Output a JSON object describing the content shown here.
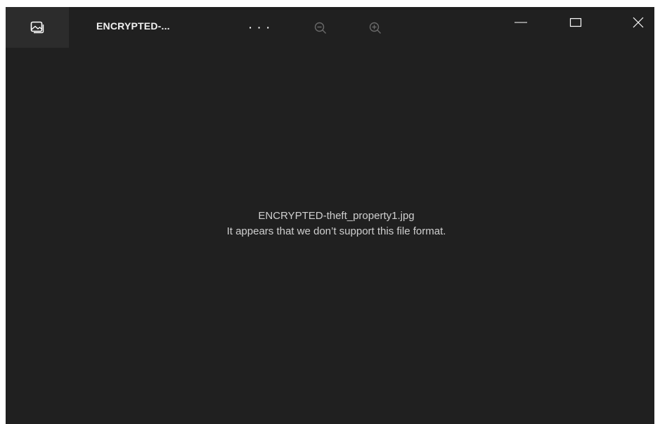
{
  "app": {
    "title": "ENCRYPTED-...",
    "more_label": "· · ·"
  },
  "icons": {
    "app": "photos-app-icon",
    "zoom_out": "zoom-out-icon",
    "zoom_in": "zoom-in-icon",
    "minimize": "minimize-icon",
    "maximize": "maximize-icon",
    "close": "close-icon"
  },
  "message": {
    "filename": "ENCRYPTED-theft_property1.jpg",
    "error": "It appears that we don’t support this file format."
  },
  "colors": {
    "background": "#202020",
    "text": "#cfcfcf",
    "disabled_icon": "#6a6a6a"
  }
}
